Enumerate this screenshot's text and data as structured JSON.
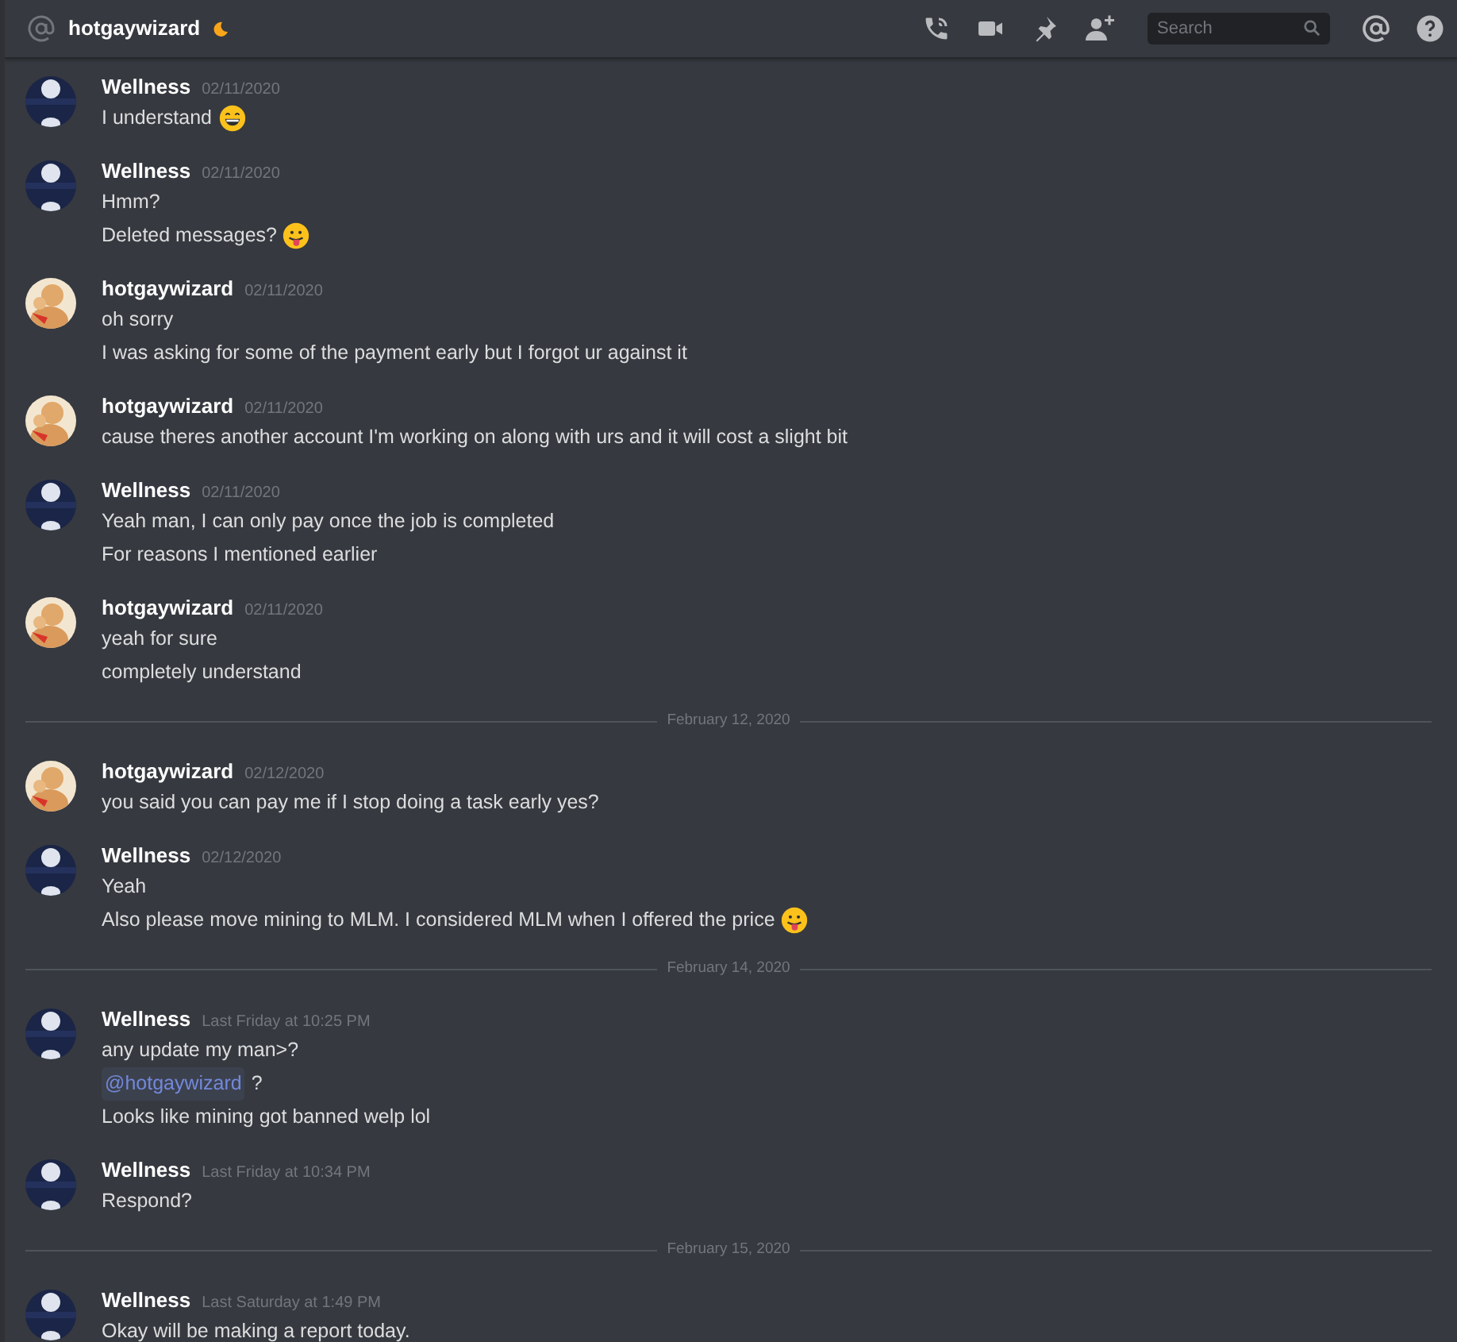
{
  "header": {
    "channel": "hotgaywizard",
    "status": {
      "kind": "idle"
    },
    "search": {
      "placeholder": "Search"
    }
  },
  "messages": [
    {
      "kind": "message",
      "avatar": {
        "kind": "moon"
      },
      "author": "Wellness",
      "time": "02/11/2020",
      "lines": [
        {
          "text": "I understand",
          "emoji": {
            "kind": "grin"
          }
        }
      ]
    },
    {
      "kind": "message",
      "avatar": {
        "kind": "moon"
      },
      "author": "Wellness",
      "time": "02/11/2020",
      "lines": [
        {
          "text": "Hmm?"
        },
        {
          "text": "Deleted messages?",
          "emoji": {
            "kind": "tongue"
          }
        }
      ]
    },
    {
      "kind": "message",
      "avatar": {
        "kind": "figure"
      },
      "author": "hotgaywizard",
      "time": "02/11/2020",
      "lines": [
        {
          "text": "oh sorry"
        },
        {
          "text": "I was asking for some of the payment early but I forgot ur against it"
        }
      ]
    },
    {
      "kind": "message",
      "avatar": {
        "kind": "figure"
      },
      "author": "hotgaywizard",
      "time": "02/11/2020",
      "lines": [
        {
          "text": "cause theres another account I'm working on along with urs and it will cost a slight bit"
        }
      ]
    },
    {
      "kind": "message",
      "avatar": {
        "kind": "moon"
      },
      "author": "Wellness",
      "time": "02/11/2020",
      "lines": [
        {
          "text": "Yeah man, I can only pay once the job is completed"
        },
        {
          "text": "For reasons I mentioned earlier"
        }
      ]
    },
    {
      "kind": "message",
      "avatar": {
        "kind": "figure"
      },
      "author": "hotgaywizard",
      "time": "02/11/2020",
      "lines": [
        {
          "text": "yeah for sure"
        },
        {
          "text": "completely understand"
        }
      ]
    },
    {
      "kind": "divider",
      "text": "February 12, 2020"
    },
    {
      "kind": "message",
      "avatar": {
        "kind": "figure"
      },
      "author": "hotgaywizard",
      "time": "02/12/2020",
      "lines": [
        {
          "text": "you said you can pay me if I stop doing a task early yes?"
        }
      ]
    },
    {
      "kind": "message",
      "avatar": {
        "kind": "moon"
      },
      "author": "Wellness",
      "time": "02/12/2020",
      "lines": [
        {
          "text": "Yeah"
        },
        {
          "text": "Also please move mining to MLM. I considered MLM when I offered the price",
          "emoji": {
            "kind": "tongue"
          }
        }
      ]
    },
    {
      "kind": "divider",
      "text": "February 14, 2020"
    },
    {
      "kind": "message",
      "avatar": {
        "kind": "moon"
      },
      "author": "Wellness",
      "time": "Last Friday at 10:25 PM",
      "lines": [
        {
          "text": "any update my man>?"
        },
        {
          "mention": "@hotgaywizard",
          "text": "?"
        },
        {
          "text": "Looks like mining got banned welp lol"
        }
      ]
    },
    {
      "kind": "message",
      "avatar": {
        "kind": "moon"
      },
      "author": "Wellness",
      "time": "Last Friday at 10:34 PM",
      "lines": [
        {
          "text": "Respond?"
        }
      ]
    },
    {
      "kind": "divider",
      "text": "February 15, 2020"
    },
    {
      "kind": "message",
      "avatar": {
        "kind": "moon"
      },
      "author": "Wellness",
      "time": "Last Saturday at 1:49 PM",
      "lines": [
        {
          "text": "Okay will be making a report today."
        }
      ]
    }
  ]
}
